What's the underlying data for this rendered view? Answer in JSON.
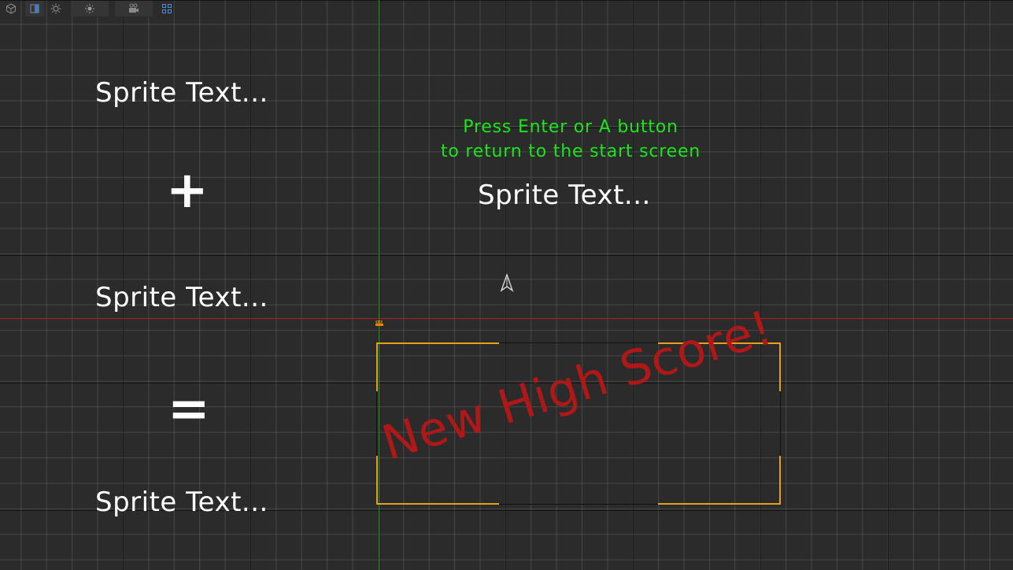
{
  "toolbar": {
    "buttons": [
      {
        "name": "cube-icon"
      },
      {
        "name": "shading-icon"
      },
      {
        "name": "lighting-icon"
      },
      {
        "name": "sun-icon"
      },
      {
        "name": "camera-icon"
      },
      {
        "name": "grid-layout-icon"
      }
    ]
  },
  "scene": {
    "sprite_text_1": "Sprite Text...",
    "plus_symbol": "+",
    "sprite_text_2": "Sprite Text...",
    "equals_symbol": "=",
    "sprite_text_3": "Sprite Text...",
    "instruction_line1": "Press Enter or A button",
    "instruction_line2": "to return to the start screen",
    "sprite_text_4": "Sprite Text...",
    "highscore_label": "New High Score!"
  },
  "colors": {
    "background": "#2b2b2b",
    "instruction": "#1be51b",
    "highscore": "#b01818",
    "selection": "#e8a01c",
    "axis_x": "#b51f1f",
    "axis_y": "#1fa11f"
  }
}
